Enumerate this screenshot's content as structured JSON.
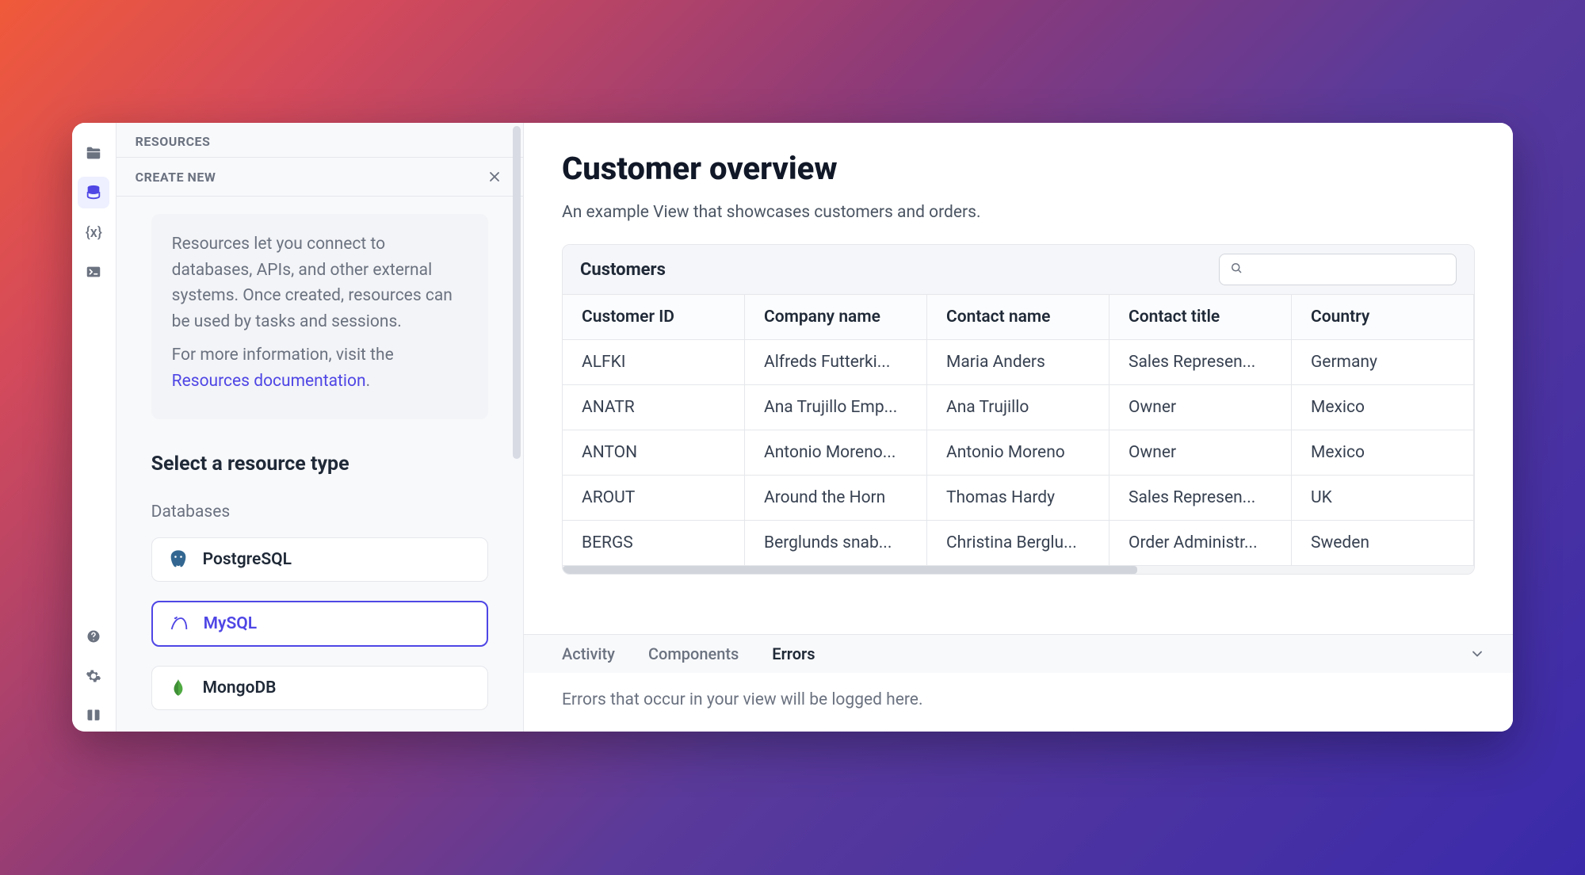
{
  "sidebar": {
    "header": "RESOURCES",
    "subheader": "CREATE NEW",
    "info_line1": "Resources let you connect to databases, APIs, and other external systems. Once created, resources can be used by tasks and sessions.",
    "info_line2_prefix": "For more information, visit the ",
    "info_link": "Resources documentation",
    "info_line2_suffix": ".",
    "select_title": "Select a resource type",
    "category_label": "Databases",
    "items": [
      {
        "label": "PostgreSQL",
        "selected": false,
        "icon": "postgresql"
      },
      {
        "label": "MySQL",
        "selected": true,
        "icon": "mysql"
      },
      {
        "label": "MongoDB",
        "selected": false,
        "icon": "mongodb"
      }
    ]
  },
  "main": {
    "title": "Customer overview",
    "description": "An example View that showcases customers and orders.",
    "table_title": "Customers",
    "search_placeholder": "",
    "columns": [
      "Customer ID",
      "Company name",
      "Contact name",
      "Contact title",
      "Country"
    ],
    "rows": [
      [
        "ALFKI",
        "Alfreds Futterki...",
        "Maria Anders",
        "Sales Represen...",
        "Germany"
      ],
      [
        "ANATR",
        "Ana Trujillo Emp...",
        "Ana Trujillo",
        "Owner",
        "Mexico"
      ],
      [
        "ANTON",
        "Antonio Moreno...",
        "Antonio Moreno",
        "Owner",
        "Mexico"
      ],
      [
        "AROUT",
        "Around the Horn",
        "Thomas Hardy",
        "Sales Represen...",
        "UK"
      ],
      [
        "BERGS",
        "Berglunds snab...",
        "Christina Berglu...",
        "Order Administr...",
        "Sweden"
      ]
    ]
  },
  "bottom": {
    "tabs": [
      "Activity",
      "Components",
      "Errors"
    ],
    "active_tab": 2,
    "errors_empty": "Errors that occur in your view will be logged here."
  }
}
